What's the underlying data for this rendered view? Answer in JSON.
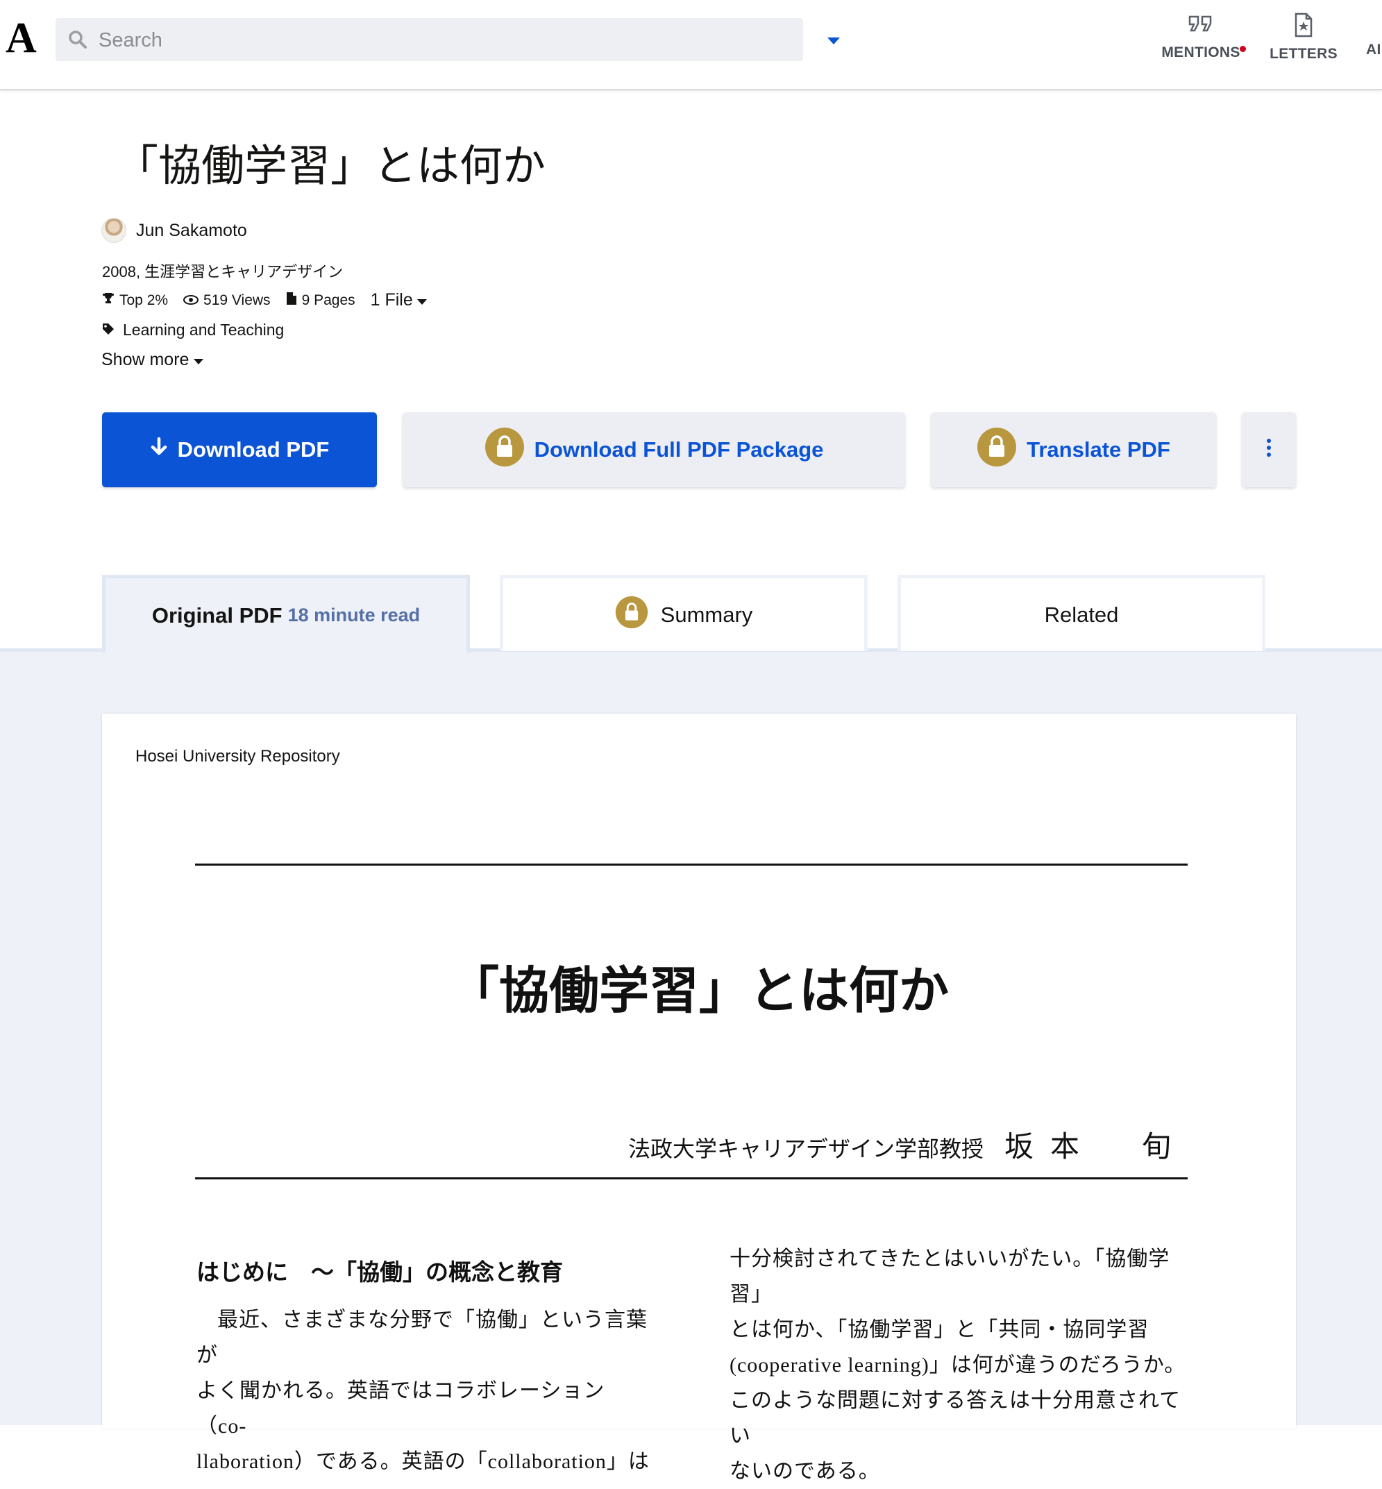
{
  "topbar": {
    "logo": "A",
    "search_placeholder": "Search",
    "nav": [
      {
        "label": "MENTIONS",
        "icon": "quote-icon",
        "has_notification": true
      },
      {
        "label": "LETTERS",
        "icon": "letter-icon"
      },
      {
        "label": "AI",
        "icon": "ai-icon"
      }
    ]
  },
  "paper": {
    "title": "「協働学習」とは何か",
    "author": "Jun Sakamoto",
    "year_journal": "2008, 生涯学習とキャリアデザイン",
    "stats": {
      "rank": "Top 2%",
      "views": "519 Views",
      "pages": "9 Pages",
      "files": "1 File"
    },
    "tag": "Learning and Teaching",
    "show_more": "Show more"
  },
  "actions": {
    "download_pdf": "Download PDF",
    "download_package": "Download Full PDF Package",
    "translate_pdf": "Translate PDF"
  },
  "tabs": {
    "original": "Original PDF",
    "read_time": "18 minute read",
    "summary": "Summary",
    "related": "Related"
  },
  "document": {
    "repository": "Hosei University Repository",
    "title": "「協働学習」とは何か",
    "affiliation": "法政大学キャリアデザイン学部教授",
    "author_name": "坂本　旬",
    "section_heading": "はじめに　～「協働」の概念と教育",
    "left_lines": [
      "最近、さまざまな分野で「協働」という言葉が",
      "よく聞かれる。英語ではコラボレーション（co-",
      "llaboration）である。英語の「collaboration」は"
    ],
    "right_lines": [
      "十分検討されてきたとはいいがたい。「協働学習」",
      "とは何か、「協働学習」と「共同・協同学習",
      "(cooperative learning)」は何が違うのだろうか。",
      "このような問題に対する答えは十分用意されてい",
      "ないのである。"
    ]
  },
  "colors": {
    "primary": "#0b54d6",
    "lock_gold": "#b8973e",
    "tab_band": "#eef1f8",
    "read_time": "#5570a6"
  }
}
